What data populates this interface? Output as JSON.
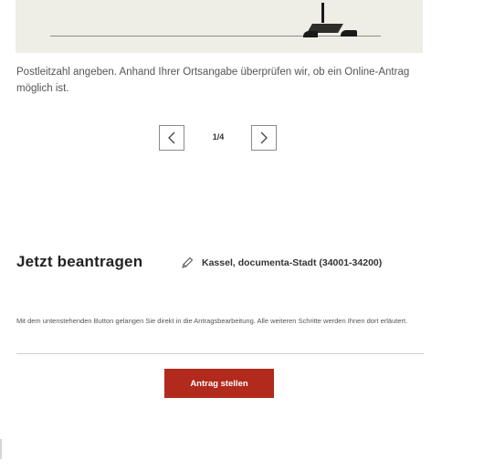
{
  "illustration": {
    "icon": "person-walking-illustration"
  },
  "intro": {
    "text": "Postleitzahl angeben. Anhand Ihrer Ortsangabe überprüfen wir, ob ein Online-Antrag möglich ist."
  },
  "pager": {
    "counter": "1/4",
    "prev_icon": "chevron-left-icon",
    "next_icon": "chevron-right-icon"
  },
  "section": {
    "title": "Jetzt beantragen",
    "location_icon": "pencil-icon",
    "location_text": "Kassel, documenta-Stadt (34001-34200)",
    "info": "Mit dem untenstehenden Button gelangen Sie direkt in die Antragsbearbeitung. Alle weiteren Schritte werden Ihnen dort erläutert.",
    "button_label": "Antrag stellen"
  },
  "colors": {
    "accent": "#b22a1c",
    "illustration_bg": "#eeede6"
  }
}
